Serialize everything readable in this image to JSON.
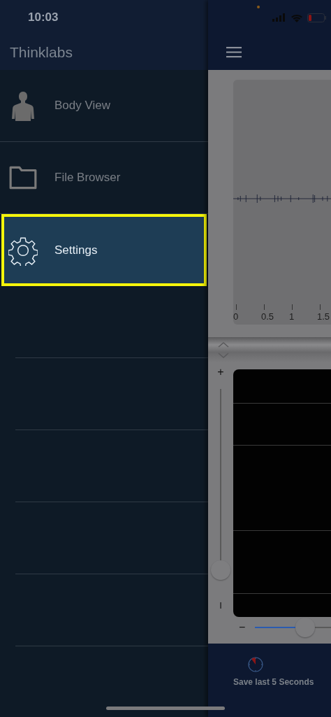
{
  "status_bar": {
    "time": "10:03"
  },
  "drawer": {
    "title": "Thinklabs",
    "items": [
      {
        "label": "Body View",
        "selected": false
      },
      {
        "label": "File Browser",
        "selected": false
      },
      {
        "label": "Settings",
        "selected": true
      }
    ]
  },
  "waveform": {
    "time_labels": [
      "0",
      "0.5",
      "1",
      "1.5"
    ]
  },
  "gain_slider": {
    "plus": "+",
    "minus": "I",
    "level": 0.04
  },
  "zoom_slider": {
    "minus": "−",
    "level": 0.4
  },
  "bottom_bar": {
    "save_label": "Save last 5 Seconds"
  }
}
